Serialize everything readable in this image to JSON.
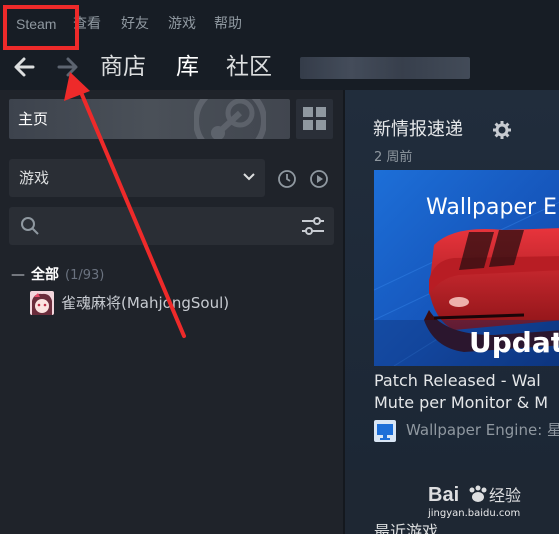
{
  "menubar": {
    "items": [
      "Steam",
      "查看",
      "好友",
      "游戏",
      "帮助"
    ]
  },
  "navbar": {
    "back_icon": "arrow-left-icon",
    "forward_icon": "arrow-right-icon",
    "store": "商店",
    "library": "库",
    "community": "社区",
    "username": "blurred-username"
  },
  "sidebar": {
    "home_label": "主页",
    "filter_label": "游戏",
    "category": {
      "name": "全部",
      "count": "(1/93)"
    },
    "games": [
      {
        "name": "雀魂麻将(MahjongSoul)"
      }
    ]
  },
  "main": {
    "news_title": "新情报速递",
    "news_time": "2 周前",
    "news_image_top": "Wallpaper E",
    "news_image_bottom": "Updat",
    "news_headline_1": "Patch Released - Wal",
    "news_headline_2": "Mute per Monitor & M",
    "news_source": "Wallpaper Engine: 星",
    "recent_title": "最近游戏"
  },
  "watermark": {
    "brand": "Bai 经验",
    "url": "jingyan.baidu.com"
  },
  "colors": {
    "menubar_bg": "#171d25",
    "sidebar_bg": "#1f232a",
    "main_bg": "#1b2838",
    "annotation": "#ee2a2a"
  }
}
